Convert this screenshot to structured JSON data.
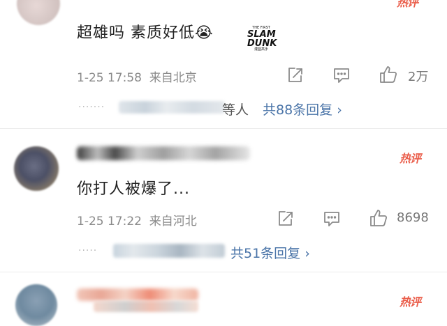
{
  "comments": [
    {
      "text": "超雄吗 素质好低",
      "emoji": "😭",
      "sticker": {
        "small": "THE FIRST",
        "line1": "SLAM",
        "line2": "DUNK",
        "tiny": "灌篮高手"
      },
      "time": "1-25 17:58",
      "location": "来自北京",
      "like_count": "2万",
      "replies_prefix": "等人",
      "replies_link": "共88条回复 ›",
      "hot_label": "热评"
    },
    {
      "text": "你打人被爆了...",
      "time": "1-25 17:22",
      "location": "来自河北",
      "like_count": "8698",
      "replies_link": "共51条回复 ›",
      "hot_label": "热评"
    },
    {
      "hot_label": "热评"
    }
  ],
  "colors": {
    "link": "#4a74a8",
    "hot": "#ea5d4a",
    "meta": "#8a8a8a"
  },
  "icons": {
    "share": "share-icon",
    "comment": "comment-icon",
    "like": "thumbs-up-icon"
  }
}
